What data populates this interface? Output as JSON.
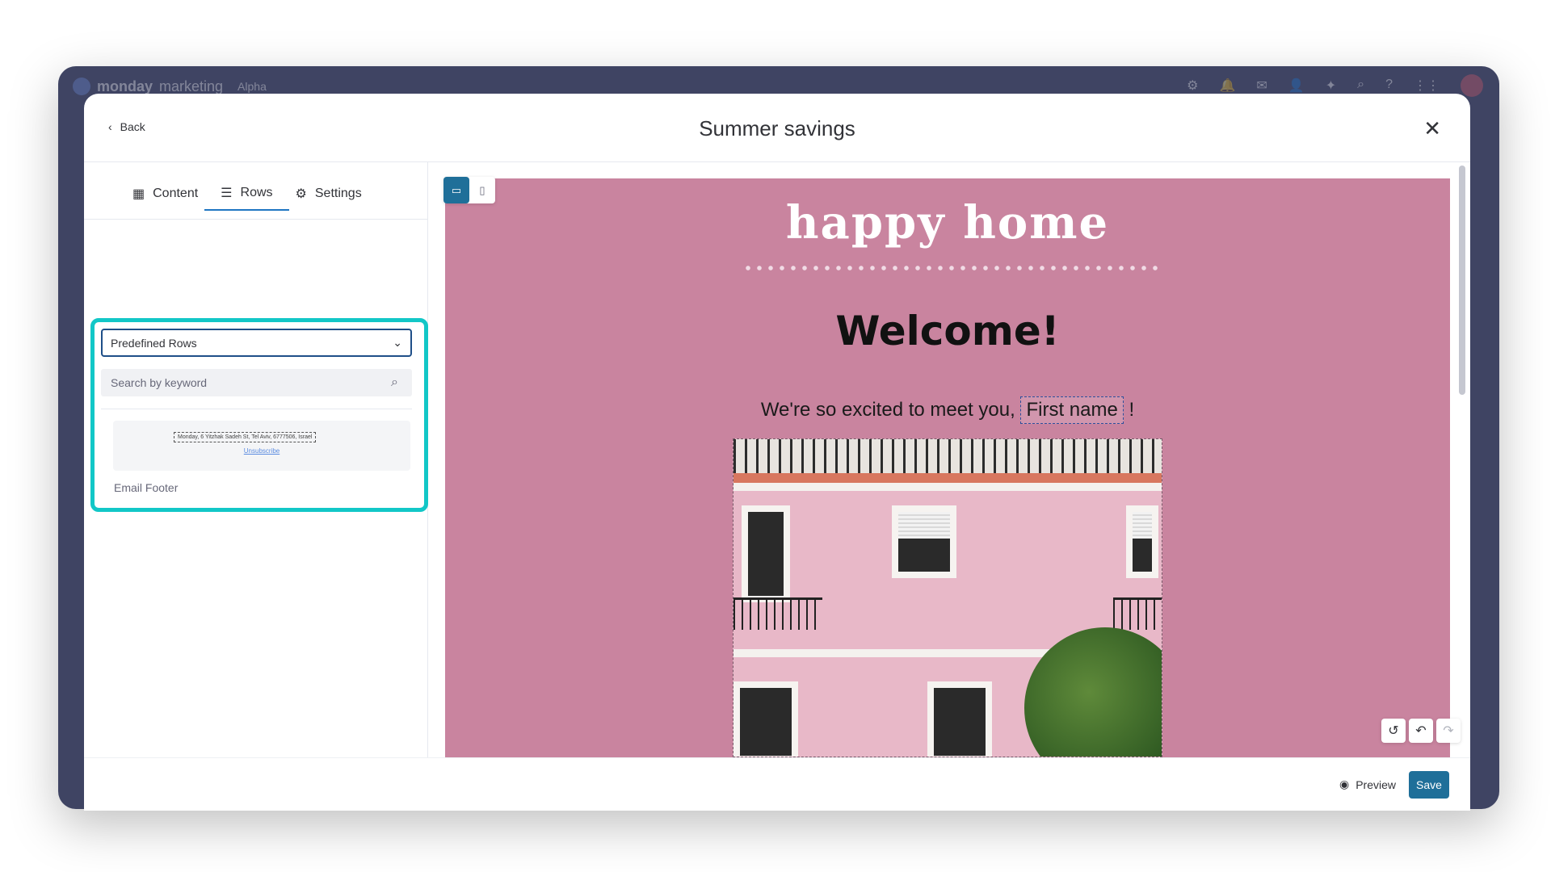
{
  "background_app": {
    "brand": "monday",
    "product": "marketing",
    "tag": "Alpha"
  },
  "header": {
    "back_label": "Back",
    "title": "Summer savings"
  },
  "sidebar": {
    "tabs": [
      {
        "label": "Content",
        "icon": "grid-icon"
      },
      {
        "label": "Rows",
        "icon": "rows-icon",
        "active": true
      },
      {
        "label": "Settings",
        "icon": "gear-icon"
      }
    ],
    "select_value": "Predefined Rows",
    "search_placeholder": "Search by keyword",
    "rows": [
      {
        "preview_address": "Monday, 6 Yitzhak Sadeh St, Tel Aviv, 6777506, Israel",
        "preview_link": "Unsubscribe",
        "label": "Email Footer"
      }
    ],
    "highlight_color": "#12c7c7"
  },
  "email": {
    "brand_text": "happy home",
    "heading": "Welcome!",
    "greeting": "We're so excited to meet you,",
    "merge_tag": "First name",
    "greeting_end": "!",
    "background_color": "#c9849f"
  },
  "footer": {
    "preview_label": "Preview",
    "save_label": "Save",
    "accent": "#1f6f99"
  }
}
